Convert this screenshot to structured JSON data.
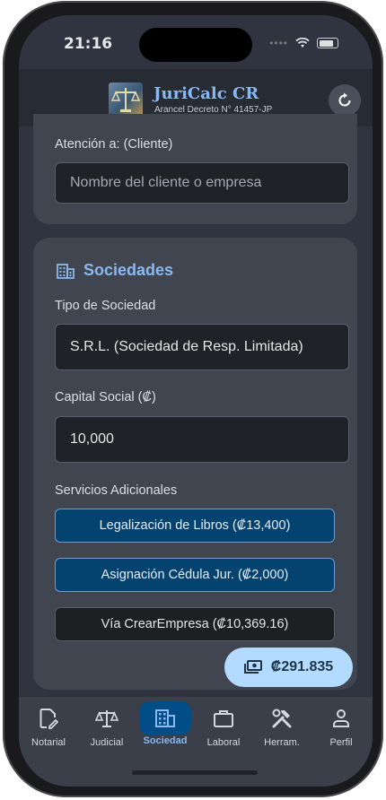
{
  "status": {
    "time": "21:16"
  },
  "header": {
    "title": "JuriCalc CR",
    "subtitle": "Arancel Decreto N° 41457-JP"
  },
  "client_card": {
    "label": "Atención a: (Cliente)",
    "input_placeholder": "Nombre del cliente o empresa"
  },
  "sociedades": {
    "title": "Sociedades",
    "tipo_label": "Tipo de Sociedad",
    "tipo_value": "S.R.L. (Sociedad de Resp. Limitada)",
    "capital_label": "Capital Social (₡)",
    "capital_value": "10,000",
    "servicios_label": "Servicios Adicionales",
    "services": [
      {
        "label": "Legalización de Libros (₡13,400)",
        "selected": true
      },
      {
        "label": "Asignación Cédula Jur. (₡2,000)",
        "selected": true
      },
      {
        "label": "Vía CrearEmpresa (₡10,369.16)",
        "selected": false
      }
    ]
  },
  "total": {
    "amount": "₡291.835"
  },
  "nav": [
    {
      "label": "Notarial",
      "icon": "document-edit-icon"
    },
    {
      "label": "Judicial",
      "icon": "scales-icon"
    },
    {
      "label": "Sociedad",
      "icon": "building-icon",
      "active": true
    },
    {
      "label": "Laboral",
      "icon": "briefcase-icon"
    },
    {
      "label": "Herram.",
      "icon": "tools-icon"
    },
    {
      "label": "Perfil",
      "icon": "person-icon"
    }
  ],
  "colors": {
    "accent": "#8ab8f0",
    "active_service": "#04426f",
    "fab": "#b3dbff",
    "background": "#2f3440"
  }
}
